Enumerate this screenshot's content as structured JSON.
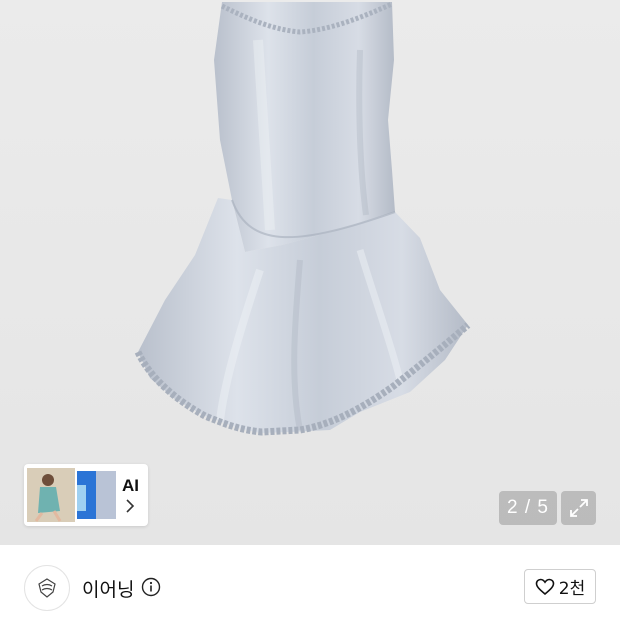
{
  "gallery": {
    "image_name": "silk-lace-slip-dress",
    "counter": "2 / 5",
    "current_page": 2,
    "total_pages": 5
  },
  "ai_chip": {
    "label": "AI"
  },
  "shop": {
    "name": "이어닝"
  },
  "like": {
    "count": "2천"
  },
  "icons": {
    "expand": "expand-icon",
    "info": "info-icon",
    "heart": "heart-icon",
    "chevron": "chevron-right-icon",
    "shop_logo": "shop-logo-icon"
  },
  "colors": {
    "dress": "#c6cdd8",
    "gallery_bg": "#e8e8e8"
  }
}
